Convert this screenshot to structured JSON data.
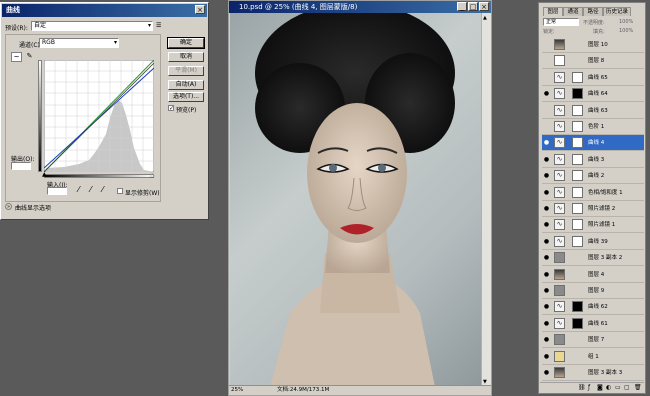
{
  "curves_dialog": {
    "title": "曲线",
    "preset_label": "预设(R):",
    "preset_value": "自定",
    "channel_label": "通道(C):",
    "channel_value": "RGB",
    "ok": "确定",
    "cancel": "取消",
    "smooth": "平滑(M)",
    "auto": "自动(A)",
    "options": "选项(T)...",
    "preview": "预览(P)",
    "output_label": "输出(O):",
    "input_label": "输入(I):",
    "show_clipping": "显示修剪(W)",
    "display_options": "曲线显示选项"
  },
  "document": {
    "title": "10.psd @ 25% (曲线 4, 图层蒙版/8)",
    "zoom": "25%",
    "doc_info": "文档:24.9M/173.1M"
  },
  "layers_panel": {
    "tabs": [
      "图层",
      "通道",
      "路径",
      "历史记录"
    ],
    "blend_mode": "正常",
    "opacity_label": "不透明度:",
    "opacity_value": "100%",
    "lock_label": "锁定:",
    "fill_label": "填充:",
    "fill_value": "100%",
    "layers": [
      {
        "name": "图层 10",
        "visible": false,
        "type": "photo"
      },
      {
        "name": "图层 8",
        "visible": false,
        "type": "white"
      },
      {
        "name": "曲线 65",
        "visible": false,
        "type": "adj"
      },
      {
        "name": "曲线 64",
        "visible": true,
        "type": "adj-black"
      },
      {
        "name": "曲线 63",
        "visible": false,
        "type": "adj"
      },
      {
        "name": "色阶 1",
        "visible": false,
        "type": "adj"
      },
      {
        "name": "曲线 4",
        "visible": true,
        "type": "adj",
        "selected": true
      },
      {
        "name": "曲线 3",
        "visible": true,
        "type": "adj"
      },
      {
        "name": "曲线 2",
        "visible": true,
        "type": "adj"
      },
      {
        "name": "色相/饱和度 1",
        "visible": true,
        "type": "adj"
      },
      {
        "name": "照片滤镜 2",
        "visible": true,
        "type": "adj"
      },
      {
        "name": "照片滤镜 1",
        "visible": true,
        "type": "adj"
      },
      {
        "name": "曲线 39",
        "visible": true,
        "type": "adj"
      },
      {
        "name": "图层 3 副本 2",
        "visible": true,
        "type": "gray"
      },
      {
        "name": "图层 4",
        "visible": true,
        "type": "photo"
      },
      {
        "name": "图层 9",
        "visible": true,
        "type": "gray"
      },
      {
        "name": "曲线 62",
        "visible": true,
        "type": "adj-black"
      },
      {
        "name": "曲线 61",
        "visible": true,
        "type": "adj-black"
      },
      {
        "name": "图层 7",
        "visible": true,
        "type": "gray"
      },
      {
        "name": "组 1",
        "visible": true,
        "type": "group"
      },
      {
        "name": "图层 3 副本 3",
        "visible": true,
        "type": "photo"
      }
    ]
  },
  "colors": {
    "titlebar": "#0a246a",
    "selected_layer": "#316ac5",
    "curve_green": "#2a9a2a",
    "curve_blue": "#1a3ac0"
  }
}
